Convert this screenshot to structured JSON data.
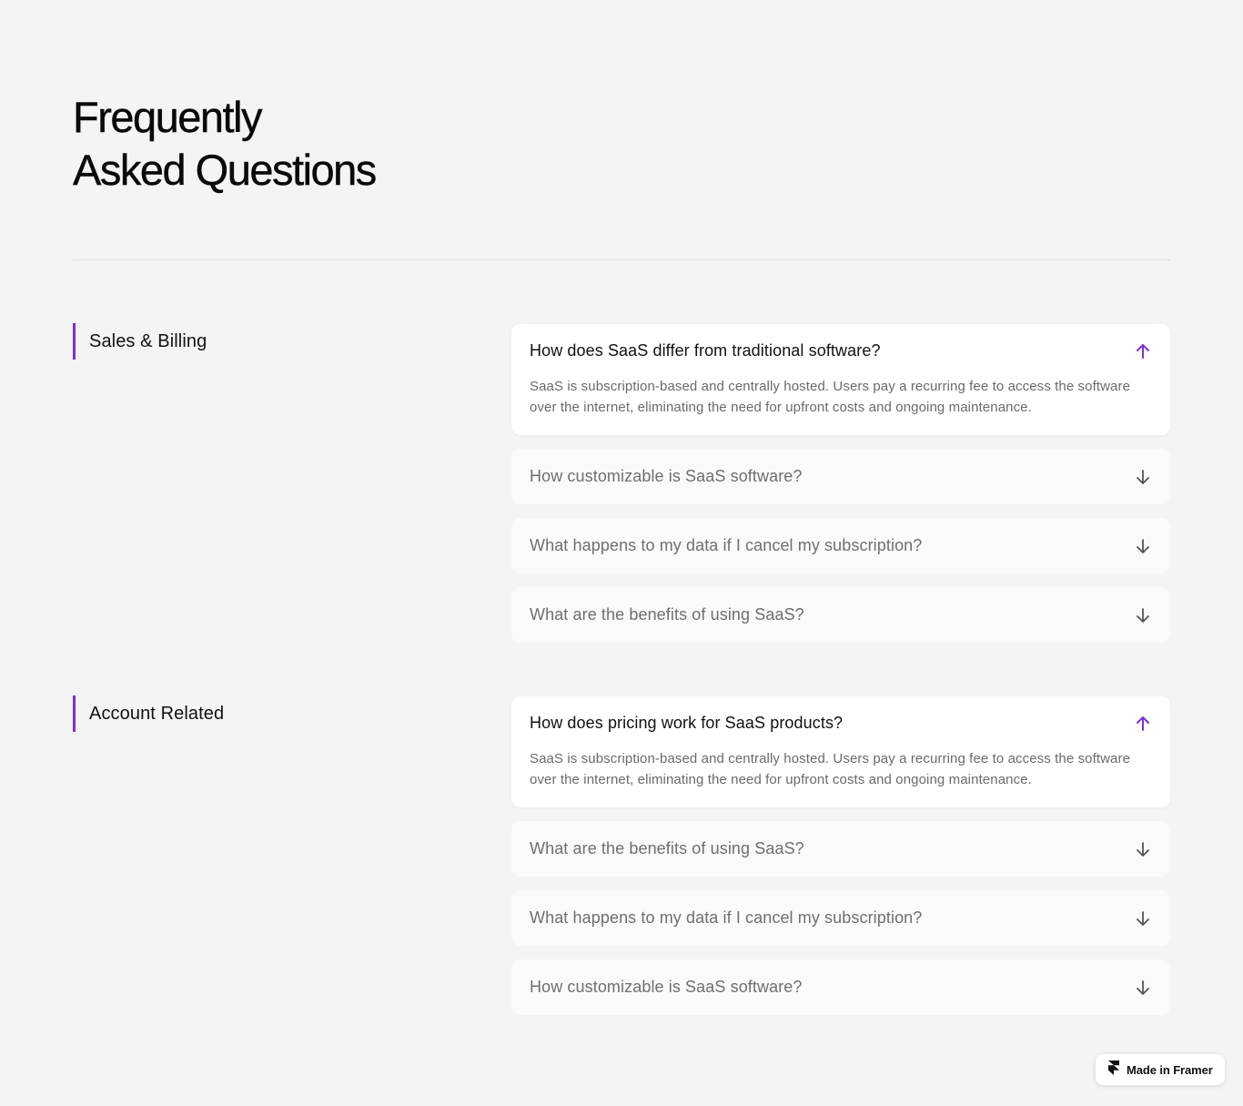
{
  "page": {
    "title_line1": "Frequently",
    "title_line2": "Asked Questions"
  },
  "accent_color": "#7b2fd6",
  "sections": [
    {
      "category": "Sales & Billing",
      "items": [
        {
          "question": "How does SaaS differ from traditional software?",
          "answer": "SaaS is subscription-based and centrally hosted. Users pay a recurring fee to access the software over the internet, eliminating the need for upfront costs and ongoing maintenance.",
          "expanded": true,
          "icon": "arrow-up-icon"
        },
        {
          "question": "How customizable is SaaS software?",
          "expanded": false,
          "icon": "arrow-down-icon"
        },
        {
          "question": "What happens to my data if I cancel my subscription?",
          "expanded": false,
          "icon": "arrow-down-icon"
        },
        {
          "question": "What are the benefits of using SaaS?",
          "expanded": false,
          "icon": "arrow-down-icon"
        }
      ]
    },
    {
      "category": "Account Related",
      "items": [
        {
          "question": "How does pricing work for SaaS products?",
          "answer": "SaaS is subscription-based and centrally hosted. Users pay a recurring fee to access the software over the internet, eliminating the need for upfront costs and ongoing maintenance.",
          "expanded": true,
          "icon": "arrow-up-icon"
        },
        {
          "question": "What are the benefits of using SaaS?",
          "expanded": false,
          "icon": "arrow-down-icon"
        },
        {
          "question": "What happens to my data if I cancel my subscription?",
          "expanded": false,
          "icon": "arrow-down-icon"
        },
        {
          "question": "How customizable is SaaS software?",
          "expanded": false,
          "icon": "arrow-down-icon"
        }
      ]
    }
  ],
  "badge": {
    "label": "Made in Framer",
    "icon": "framer-logo-icon"
  }
}
